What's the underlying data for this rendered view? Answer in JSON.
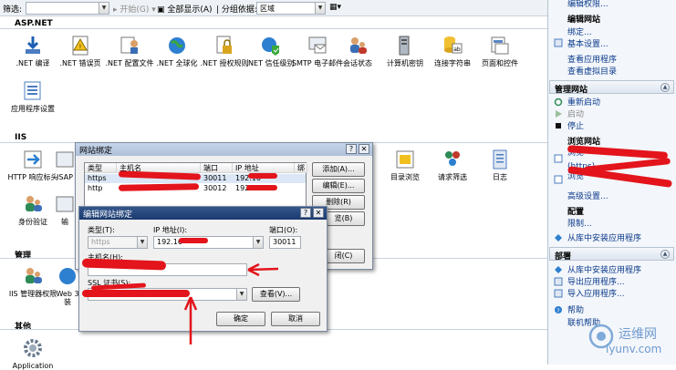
{
  "filterbar": {
    "filter_label": "筛选:",
    "start_label": "开始(G)",
    "show_all_label": "全部显示(A)",
    "group_label": "分组依据:",
    "group_value": "区域"
  },
  "sections": {
    "aspnet": "ASP.NET",
    "iis": "IIS",
    "manage": "管理",
    "other": "其他"
  },
  "aspnet_items": [
    ".NET 编译",
    ".NET 错误页",
    ".NET 配置文件",
    ".NET 全球化",
    ".NET 授权规则",
    ".NET 信任级别",
    "SMTP 电子邮件",
    "会话状态",
    "计算机密钥",
    "连接字符串",
    "页面和控件",
    "应用程序设置"
  ],
  "iis_items": {
    "http_response": "HTTP 响应标头",
    "isapi": "ISAP",
    "auth": "身份验证",
    "output": "输",
    "dir_browse": "目录浏览",
    "req_filter": "请求筛选",
    "log": "日志"
  },
  "manage_items": {
    "iis_mgr": "IIS 管理器权限",
    "webdeploy": "Web 3 装"
  },
  "other_items": {
    "app": "Application"
  },
  "actions": {
    "top_items": [
      "编辑权限...",
      "编辑网站",
      "绑定...",
      "基本设置...",
      "查看应用程序",
      "查看虚拟目录"
    ],
    "manage_header": "管理网站",
    "manage_items": [
      "重新启动",
      "启动",
      "停止"
    ],
    "browse_header": "浏览网站",
    "browse_items": [
      "浏览",
      "(https)",
      "浏览"
    ],
    "advanced": "高级设置...",
    "config_header": "配置",
    "limits": "限制...",
    "gallery_install": "从库中安装应用程序",
    "deploy_header": "部署",
    "deploy_items": [
      "从库中安装应用程序",
      "导出应用程序...",
      "导入应用程序..."
    ],
    "help_items": [
      "帮助",
      "联机帮助"
    ]
  },
  "site_bindings": {
    "title": "网站绑定",
    "columns": [
      "类型",
      "主机名",
      "端口",
      "IP 地址",
      "绑"
    ],
    "rows": [
      {
        "type": "https",
        "host": "",
        "port": "30011",
        "ip": "192.16"
      },
      {
        "type": "http",
        "host": "",
        "port": "30012",
        "ip": "192.16"
      }
    ],
    "buttons": [
      "添加(A)...",
      "编辑(E)...",
      "删除(R)",
      "览(B)",
      "闭(C)"
    ]
  },
  "edit_binding": {
    "title": "编辑网站绑定",
    "type_label": "类型(T):",
    "type_value": "https",
    "ip_label": "IP 地址(I):",
    "ip_value": "192.16",
    "port_label": "端口(O):",
    "port_value": "30011",
    "host_label": "主机名(H):",
    "ssl_label": "SSL 证书(S):",
    "view_button": "查看(V)...",
    "ok_button": "确定",
    "cancel_button": "取消"
  },
  "watermark": {
    "cn": "运维网",
    "en": "iyunv.com"
  }
}
